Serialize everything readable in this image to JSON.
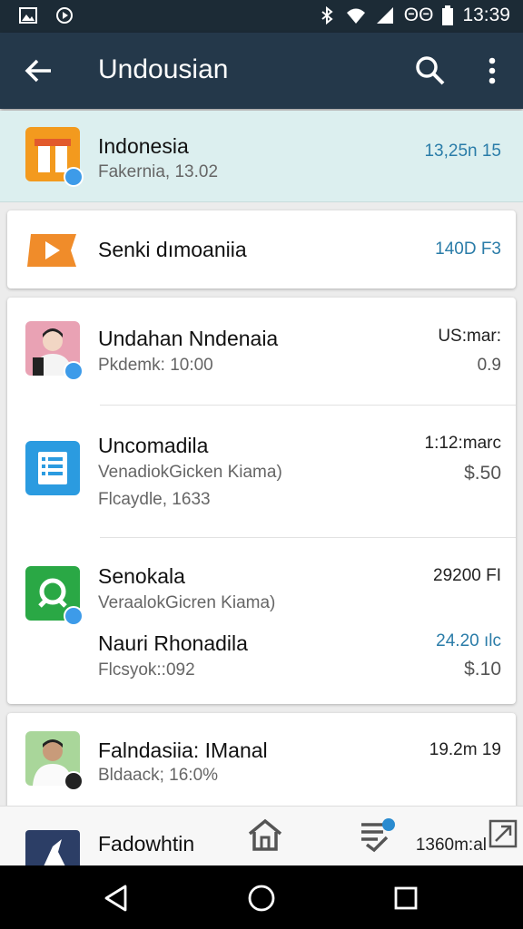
{
  "statusbar": {
    "signal_text": "ΘΘ",
    "time": "13:39"
  },
  "appbar": {
    "title": "Undousian"
  },
  "featured": {
    "title": "Indonesia",
    "subtitle": "Fakernia, 13.02",
    "value": "13,25n 15"
  },
  "item2": {
    "title": "Senki dımoaniia",
    "value": "140D F3"
  },
  "group": [
    {
      "title": "Undahan Nndenaia",
      "subtitle": "Pkdemk: 10:00",
      "right_top": "US:mar:",
      "right_bottom": "0.9"
    },
    {
      "title": "Uncomadila",
      "subtitle": "VenadiokGicken Kiama)",
      "subtitle2": "Flcaydle, 1633",
      "right_top": "1:12:marc",
      "right_bottom": "$.50"
    },
    {
      "title": "Senokala",
      "subtitle": "VeraalokGicren Kiama)",
      "right_top": "29200 FI"
    },
    {
      "title": "Nauri Rhonadila",
      "subtitle": "Flcsyok::092",
      "right_top": "24.20 ılc",
      "right_bottom": "$.10"
    }
  ],
  "last": {
    "title": "Falndasiia: IManal",
    "subtitle": "Bldaack; 16:0%",
    "value": "19.2m 19"
  },
  "partial": {
    "title": "Fadowhtin",
    "value": "1360m:al"
  },
  "colors": {
    "accent_blue": "#2a7ca8",
    "appbar": "#24384a",
    "featured_bg": "#dcefef"
  }
}
